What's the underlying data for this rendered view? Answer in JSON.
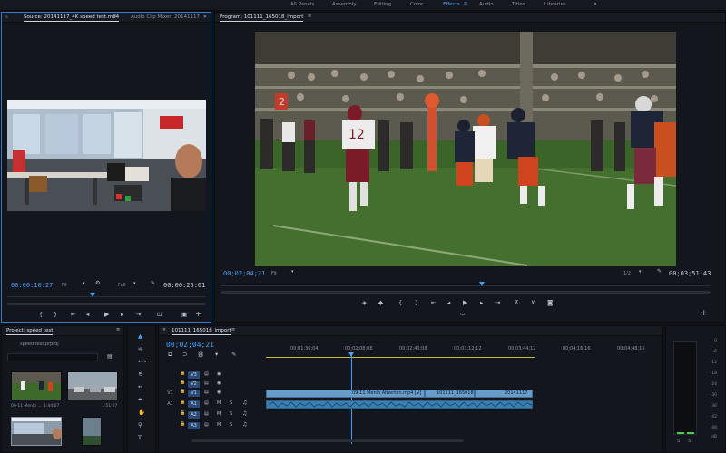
{
  "workspaces": [
    "All Panels",
    "Assembly",
    "Editing",
    "Color",
    "Effects",
    "Audio",
    "Titles",
    "Libraries"
  ],
  "workspace_active": "Effects",
  "source": {
    "tab_active": "Source: 20141117_4K speed test.mp4",
    "tab_other": "Audio Clip Mixer: 20141117",
    "timecode_current": "00:00:10:27",
    "zoom": "Fit",
    "resolution": "Full",
    "timecode_duration": "00:00:25:01"
  },
  "program": {
    "tab_active": "Program: 101111_165018_import",
    "timecode_current": "00;02;04;21",
    "zoom": "Fit",
    "resolution": "1/2",
    "timecode_duration": "00;03;51;43"
  },
  "project": {
    "tab": "Project: speed test",
    "file": "speed test.prproj",
    "items": [
      {
        "name": "09-11 Menlo ...",
        "duration": "1:44:07"
      },
      {
        "name": "",
        "duration": "1:51:07"
      },
      {
        "name": "",
        "duration": ""
      },
      {
        "name": "",
        "duration": ""
      }
    ]
  },
  "timeline": {
    "tab": "101111_165018_import",
    "timecode": "00;02;04;21",
    "ruler": [
      "00;01;36;04",
      "00;02;08;08",
      "00;02;40;08",
      "00;03;12;12",
      "00;03;44;12",
      "00;04;16;16",
      "00;04;48;16"
    ],
    "video_tracks": [
      "V3",
      "V2",
      "V1"
    ],
    "audio_tracks": [
      "A1",
      "A2",
      "A3"
    ],
    "src_video": "V1",
    "src_audio": "A1",
    "track_m": "M",
    "track_s": "S",
    "clip_v1_a": "09-11 Menlo Atherton.mp4 [V]",
    "clip_v1_b": "101111_165018",
    "clip_v1_c": "20141117"
  },
  "meter": {
    "ticks": [
      "0",
      "-6",
      "-12",
      "-18",
      "-24",
      "-30",
      "-36",
      "-42",
      "-48",
      "dB"
    ],
    "solo": [
      "S",
      "S"
    ]
  }
}
